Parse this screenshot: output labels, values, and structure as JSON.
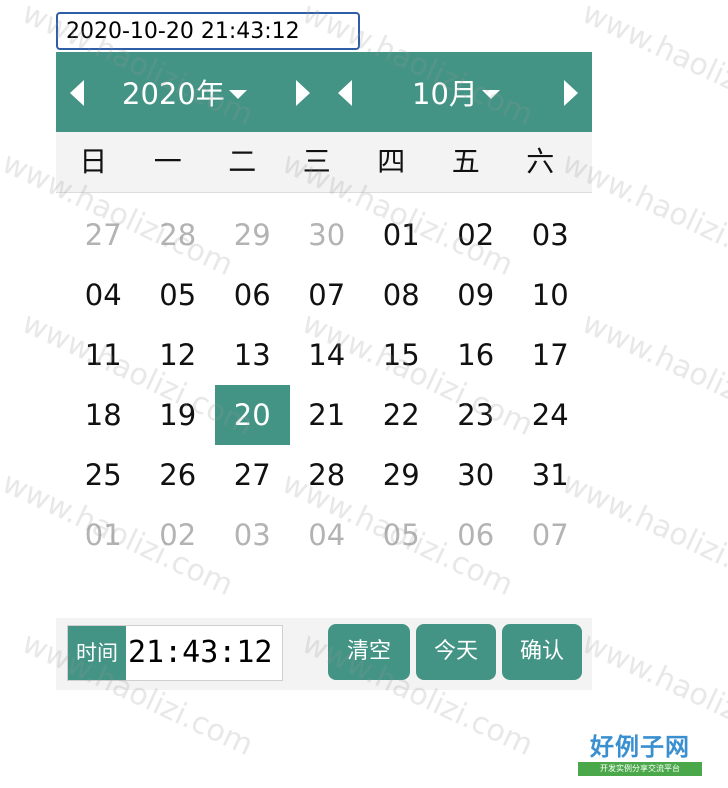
{
  "input": {
    "value": "2020-10-20 21:43:12"
  },
  "header": {
    "year_label": "2020年",
    "month_label": "10月"
  },
  "weekdays": [
    "日",
    "一",
    "二",
    "三",
    "四",
    "五",
    "六"
  ],
  "calendar": {
    "rows": [
      [
        {
          "d": "27",
          "other": true
        },
        {
          "d": "28",
          "other": true
        },
        {
          "d": "29",
          "other": true
        },
        {
          "d": "30",
          "other": true
        },
        {
          "d": "01"
        },
        {
          "d": "02"
        },
        {
          "d": "03"
        }
      ],
      [
        {
          "d": "04"
        },
        {
          "d": "05"
        },
        {
          "d": "06"
        },
        {
          "d": "07"
        },
        {
          "d": "08"
        },
        {
          "d": "09"
        },
        {
          "d": "10"
        }
      ],
      [
        {
          "d": "11"
        },
        {
          "d": "12"
        },
        {
          "d": "13"
        },
        {
          "d": "14"
        },
        {
          "d": "15"
        },
        {
          "d": "16"
        },
        {
          "d": "17"
        }
      ],
      [
        {
          "d": "18"
        },
        {
          "d": "19"
        },
        {
          "d": "20",
          "selected": true
        },
        {
          "d": "21"
        },
        {
          "d": "22"
        },
        {
          "d": "23"
        },
        {
          "d": "24"
        }
      ],
      [
        {
          "d": "25"
        },
        {
          "d": "26"
        },
        {
          "d": "27"
        },
        {
          "d": "28"
        },
        {
          "d": "29"
        },
        {
          "d": "30"
        },
        {
          "d": "31"
        }
      ],
      [
        {
          "d": "01",
          "other": true
        },
        {
          "d": "02",
          "other": true
        },
        {
          "d": "03",
          "other": true
        },
        {
          "d": "04",
          "other": true
        },
        {
          "d": "05",
          "other": true
        },
        {
          "d": "06",
          "other": true
        },
        {
          "d": "07",
          "other": true
        }
      ]
    ]
  },
  "footer": {
    "time_label": "时间",
    "time_value": "21:43:12",
    "clear_label": "清空",
    "today_label": "今天",
    "confirm_label": "确认"
  },
  "watermark": {
    "text": "www.haolizi.com"
  },
  "logo": {
    "title": "好例子网",
    "subtitle": "开发实例分享交流平台"
  },
  "colors": {
    "accent": "#439485",
    "input_border": "#2f5ea8",
    "other_month_text": "#b3b3b3"
  },
  "icons": {
    "prev_year": "triangle-left-icon",
    "next_year": "triangle-right-icon",
    "prev_month": "triangle-left-icon",
    "next_month": "triangle-right-icon",
    "dropdown": "caret-down-icon"
  }
}
